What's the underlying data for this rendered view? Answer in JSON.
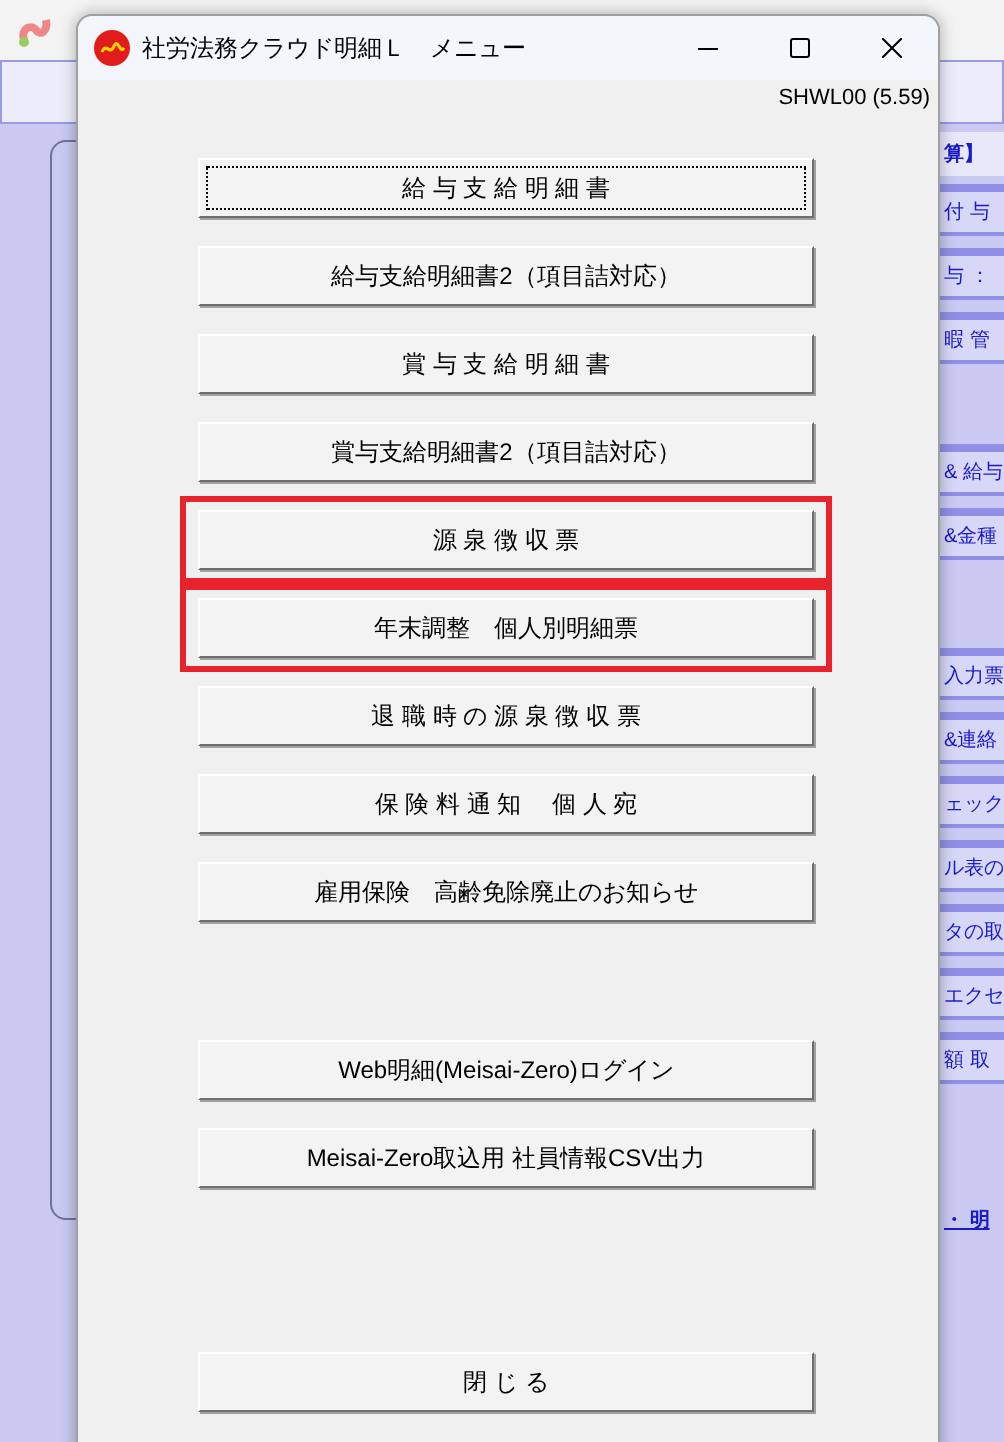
{
  "background_window": {
    "side_items": [
      {
        "text": "算】",
        "kind": "header"
      },
      {
        "text": "付 与",
        "kind": "item"
      },
      {
        "text": "与 ：",
        "kind": "item"
      },
      {
        "text": "暇 管",
        "kind": "item"
      },
      {
        "text": "& 給与",
        "kind": "item"
      },
      {
        "text": "&金種",
        "kind": "item"
      },
      {
        "text": "入力票",
        "kind": "item"
      },
      {
        "text": "&連絡",
        "kind": "item"
      },
      {
        "text": "ェック",
        "kind": "item"
      },
      {
        "text": "ル表の",
        "kind": "item"
      },
      {
        "text": "タの取",
        "kind": "item"
      },
      {
        "text": "エクセ",
        "kind": "item"
      },
      {
        "text": "額 取",
        "kind": "item"
      },
      {
        "text": "・ 明",
        "kind": "link"
      }
    ]
  },
  "window": {
    "title": "社労法務クラウド明細Ｌ　メニュー",
    "screen_id": "SHWL00 (5.59)"
  },
  "menu_buttons": [
    {
      "label": "給 与 支 給 明 細 書",
      "focused": true,
      "highlighted": false
    },
    {
      "label": "給与支給明細書2（項目詰対応）",
      "focused": false,
      "highlighted": false
    },
    {
      "label": "賞 与 支 給 明 細 書",
      "focused": false,
      "highlighted": false
    },
    {
      "label": "賞与支給明細書2（項目詰対応）",
      "focused": false,
      "highlighted": false
    },
    {
      "label": "源 泉 徴 収 票",
      "focused": false,
      "highlighted": true
    },
    {
      "label": "年末調整　個人別明細票",
      "focused": false,
      "highlighted": true
    },
    {
      "label": "退 職 時 の 源 泉 徴 収 票",
      "focused": false,
      "highlighted": false
    },
    {
      "label": "保 険 料 通 知　 個 人 宛",
      "focused": false,
      "highlighted": false
    },
    {
      "label": "雇用保険　高齢免除廃止のお知らせ",
      "focused": false,
      "highlighted": false
    }
  ],
  "web_buttons": [
    {
      "label": "Web明細(Meisai-Zero)ログイン",
      "focused": false,
      "highlighted": false
    },
    {
      "label": "Meisai-Zero取込用 社員情報CSV出力",
      "focused": false,
      "highlighted": false
    }
  ],
  "close_button": {
    "label": "閉 じ る"
  }
}
